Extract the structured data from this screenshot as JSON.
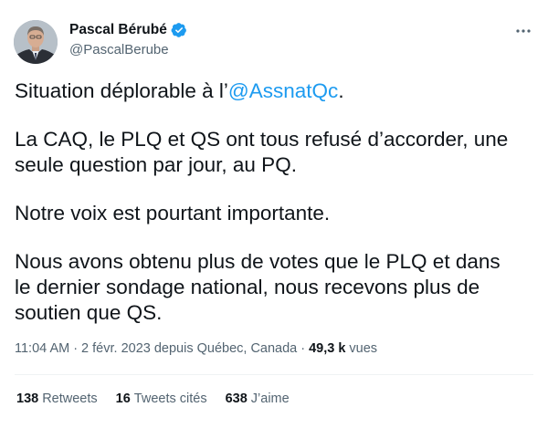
{
  "author": {
    "name": "Pascal Bérubé",
    "handle": "@PascalBerube",
    "verified": true
  },
  "tweet": {
    "p1_before": "Situation déplorable à l’",
    "p1_mention": "@AssnatQc",
    "p1_after": ".",
    "p2_line1": "La CAQ, le PLQ et QS ont tous refusé d’accorder, une",
    "p2_line2": "seule question par jour, au PQ.",
    "p3": "Notre voix est pourtant importante.",
    "p4_line1": "Nous avons obtenu plus de votes que le PLQ et dans",
    "p4_line2": "le dernier sondage national, nous recevons plus de",
    "p4_line3": "soutien que QS."
  },
  "meta": {
    "time": "11:04 AM",
    "separator1": "·",
    "date_source": "2 févr. 2023 depuis Québec, Canada",
    "separator2": "·",
    "views_count": "49,3 k",
    "views_label": "vues"
  },
  "stats": {
    "retweets_count": "138",
    "retweets_label": "Retweets",
    "quotes_count": "16",
    "quotes_label": "Tweets cités",
    "likes_count": "638",
    "likes_label": "J’aime"
  },
  "colors": {
    "accent": "#1d9bf0",
    "secondary_text": "#536471",
    "primary_text": "#0f1419"
  }
}
